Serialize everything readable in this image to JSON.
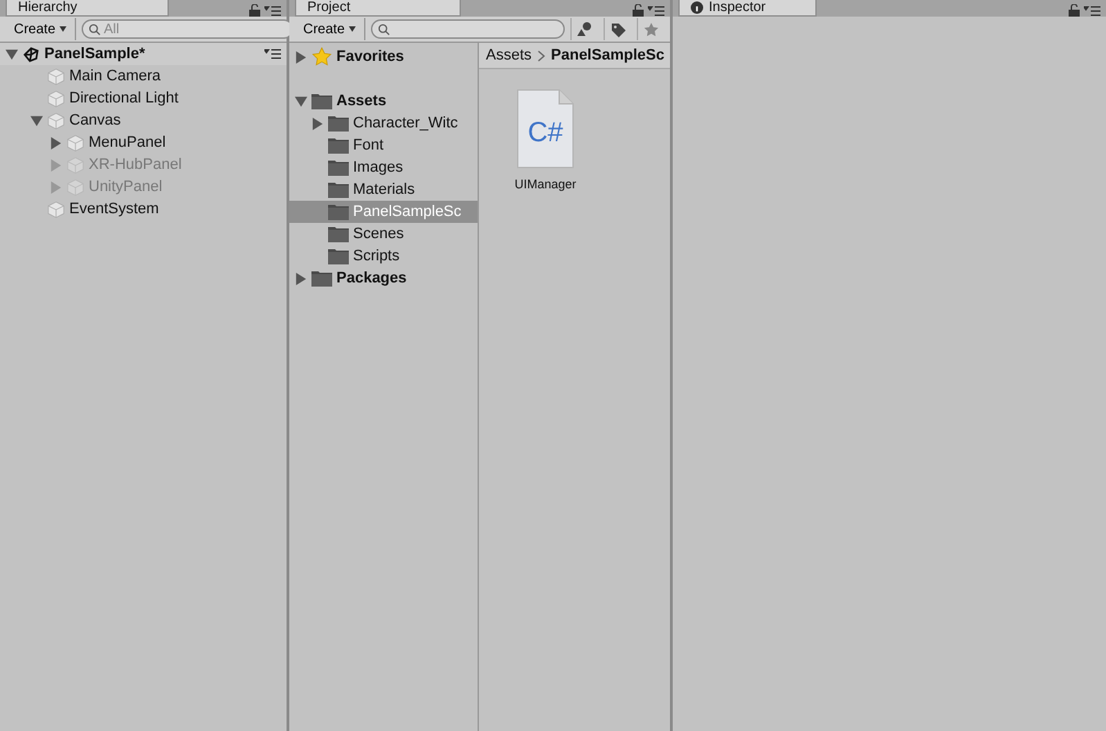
{
  "hierarchy": {
    "tab": "Hierarchy",
    "create": "Create",
    "search": {
      "placeholder": "All"
    },
    "scene": {
      "name": "PanelSample*",
      "expanded": true
    },
    "items": [
      {
        "label": "Main Camera",
        "disabled": false
      },
      {
        "label": "Directional Light",
        "disabled": false
      },
      {
        "label": "Canvas",
        "disabled": false,
        "expanded": true,
        "children": [
          {
            "label": "MenuPanel",
            "disabled": false,
            "expanded": false
          },
          {
            "label": "XR-HubPanel",
            "disabled": true,
            "expanded": false
          },
          {
            "label": "UnityPanel",
            "disabled": true,
            "expanded": false
          }
        ]
      },
      {
        "label": "EventSystem",
        "disabled": false
      }
    ]
  },
  "project": {
    "tab": "Project",
    "create": "Create",
    "tree": [
      {
        "label": "Favorites",
        "kind": "favorites",
        "expanded": false,
        "selected": false
      },
      {
        "label": "Assets",
        "kind": "folder",
        "expanded": true,
        "selected": false,
        "children": [
          {
            "label": "Character_Witc",
            "kind": "folder",
            "expanded": false,
            "selected": false
          },
          {
            "label": "Font",
            "kind": "folder",
            "selected": false
          },
          {
            "label": "Images",
            "kind": "folder",
            "selected": false
          },
          {
            "label": "Materials",
            "kind": "folder",
            "selected": false
          },
          {
            "label": "PanelSampleSc",
            "kind": "folder",
            "selected": true
          },
          {
            "label": "Scenes",
            "kind": "folder",
            "selected": false
          },
          {
            "label": "Scripts",
            "kind": "folder",
            "selected": false
          }
        ]
      },
      {
        "label": "Packages",
        "kind": "folder",
        "expanded": false,
        "selected": false
      }
    ],
    "breadcrumb": [
      "Assets",
      "PanelSampleSc"
    ],
    "files": [
      {
        "name": "UIManager",
        "icon_text": "C#"
      }
    ]
  },
  "inspector": {
    "tab": "Inspector"
  }
}
